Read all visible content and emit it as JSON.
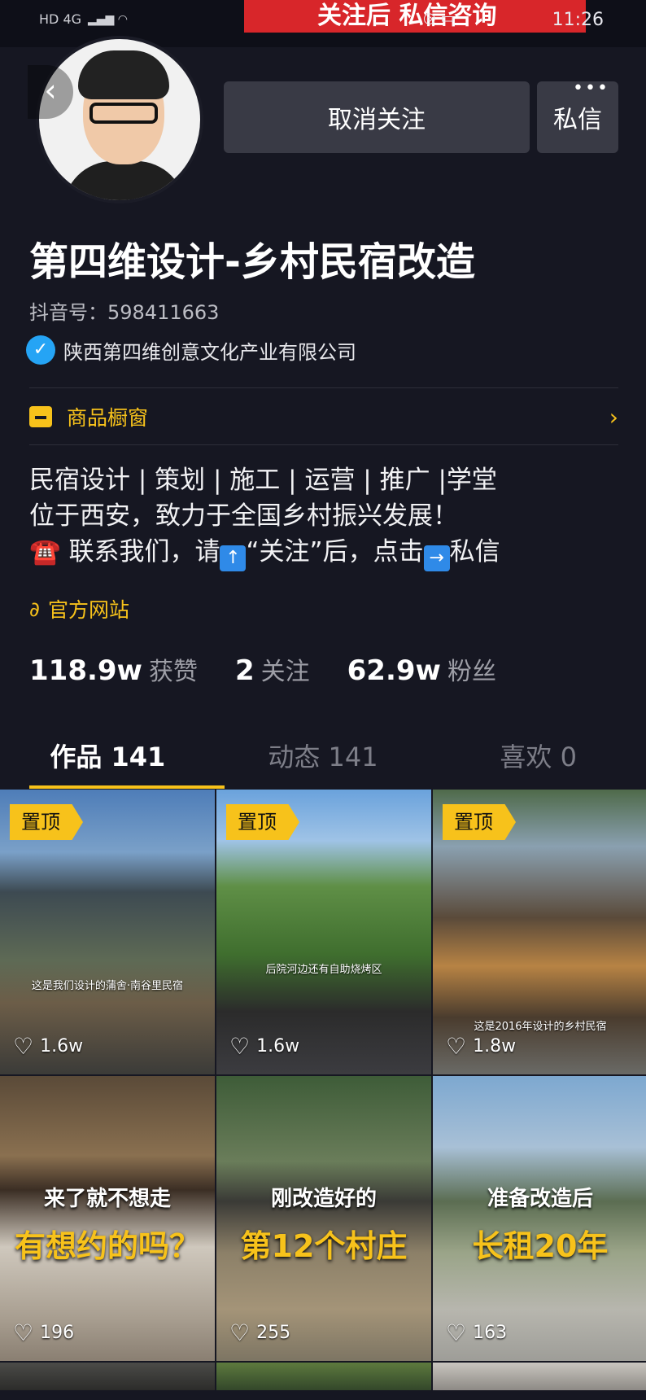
{
  "status": {
    "left_icons": "HD 4G",
    "banner_text": "关注后 私信咨询",
    "time": "11:26"
  },
  "header": {
    "back_glyph": "‹",
    "unfollow_label": "取消关注",
    "message_label": "私信",
    "more_glyph": "•••"
  },
  "profile": {
    "name": "第四维设计-乡村民宿改造",
    "douyin_id": "抖音号：598411663",
    "verified_org": "陕西第四维创意文化产业有限公司",
    "shop_label": "商品橱窗",
    "bio_line1": "民宿设计 | 策划 | 施工 | 运营 | 推广 |学堂",
    "bio_line2": "位于西安，致力于全国乡村振兴发展！",
    "bio_line3_a": "☎️ 联系我们，请",
    "bio_line3_b": "“关注”后，点击",
    "bio_line3_c": "私信",
    "website_label": "官方网站"
  },
  "stats": [
    {
      "num": "118.9w",
      "label": "获赞"
    },
    {
      "num": "2",
      "label": "关注"
    },
    {
      "num": "62.9w",
      "label": "粉丝"
    }
  ],
  "tabs": [
    {
      "label": "作品 141"
    },
    {
      "label": "动态 141"
    },
    {
      "label": "喜欢 0"
    }
  ],
  "videos": [
    {
      "pinned": "置顶",
      "caption": "这是我们设计的蒲舍·南谷里民宿",
      "likes": "1.6w"
    },
    {
      "pinned": "置顶",
      "caption": "后院河边还有自助烧烤区",
      "likes": "1.6w"
    },
    {
      "pinned": "置顶",
      "caption": "这是2016年设计的乡村民宿",
      "likes": "1.8w"
    },
    {
      "line1": "来了就不想走",
      "line2": "有想约的吗？",
      "likes": "196"
    },
    {
      "line1": "刚改造好的",
      "line2": "第12个村庄",
      "likes": "255"
    },
    {
      "line1": "准备改造后",
      "line2": "长租20年",
      "likes": "163"
    }
  ],
  "colors": {
    "background": "#161722",
    "accent": "#f7c21b",
    "button": "#393a45",
    "verified": "#25a4f5"
  }
}
